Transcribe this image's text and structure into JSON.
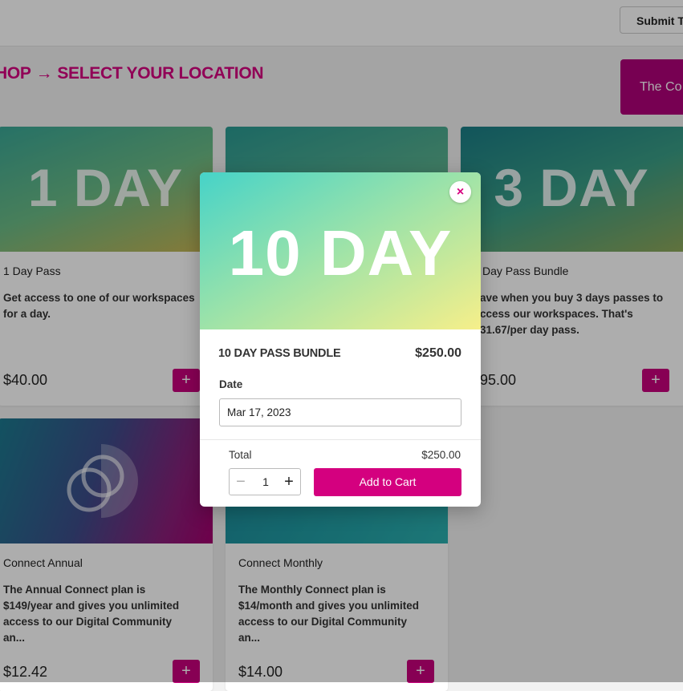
{
  "header": {
    "submit_label": "Submit Ti"
  },
  "breadcrumb": {
    "shop": "HOP",
    "arrow": "→",
    "current": "SELECT YOUR LOCATION"
  },
  "community_button": "The Co",
  "products": [
    {
      "banner": "1 DAY",
      "title": "1 Day Pass",
      "description": "Get access to one of our workspaces for a day.",
      "price": "$40.00",
      "add": "+"
    },
    {
      "banner": "3 DAY",
      "title": "Day Pass Bundle",
      "description": "ave when you buy 3 days passes to ccess our workspaces. That's 31.67/per day pass.",
      "price": "95.00",
      "add": "+"
    },
    {
      "title": "Connect Annual",
      "description": "The Annual Connect plan is $149/year and gives you unlimited access to our Digital Community an...",
      "price": "$12.42",
      "add": "+"
    },
    {
      "title": "Connect Monthly",
      "description": "The Monthly Connect plan is $14/month and gives you unlimited access to our Digital Community an...",
      "price": "$14.00",
      "add": "+"
    }
  ],
  "modal": {
    "banner": "10 DAY",
    "close": "×",
    "title": "10 DAY PASS BUNDLE",
    "price": "$250.00",
    "date_label": "Date",
    "date_value": "Mar 17, 2023",
    "total_label": "Total",
    "total_value": "$250.00",
    "qty_minus": "−",
    "quantity": "1",
    "qty_plus": "+",
    "add_to_cart": "Add to Cart"
  },
  "colors": {
    "brand_pink": "#d6007f",
    "brand_magenta_dark": "#b0007a",
    "modal_gradient": [
      "#46d3c8",
      "#9fe3a8",
      "#f6ef8a"
    ],
    "overlay": "rgba(0,0,0,0.32)"
  }
}
